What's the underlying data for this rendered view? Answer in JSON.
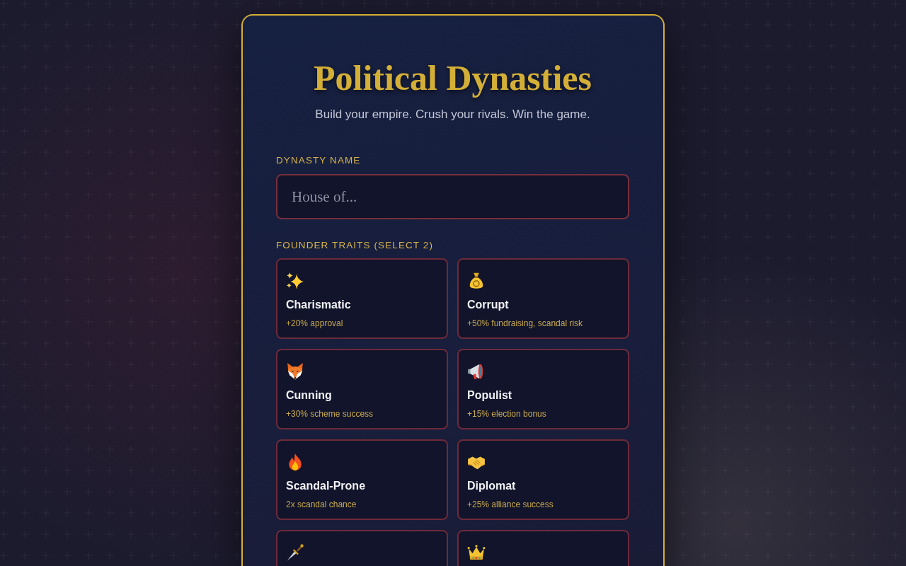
{
  "header": {
    "title": "Political Dynasties",
    "subtitle": "Build your empire. Crush your rivals. Win the game."
  },
  "dynasty_name": {
    "label": "DYNASTY NAME",
    "placeholder": "House of..."
  },
  "founder_traits": {
    "label": "FOUNDER TRAITS (SELECT 2)",
    "traits": [
      {
        "kind": "sparkles",
        "name": "Charismatic",
        "effect": "+20% approval",
        "selected": false
      },
      {
        "kind": "moneybag",
        "name": "Corrupt",
        "effect": "+50% fundraising, scandal risk",
        "selected": false
      },
      {
        "kind": "fox",
        "name": "Cunning",
        "effect": "+30% scheme success",
        "selected": false
      },
      {
        "kind": "megaphone",
        "name": "Populist",
        "effect": "+15% election bonus",
        "selected": false
      },
      {
        "kind": "fire",
        "name": "Scandal-Prone",
        "effect": "2x scandal chance",
        "selected": false
      },
      {
        "kind": "handshake",
        "name": "Diplomat",
        "effect": "+25% alliance success",
        "selected": false
      },
      {
        "kind": "dagger",
        "selected": false
      },
      {
        "kind": "crown",
        "selected": false
      }
    ]
  }
}
